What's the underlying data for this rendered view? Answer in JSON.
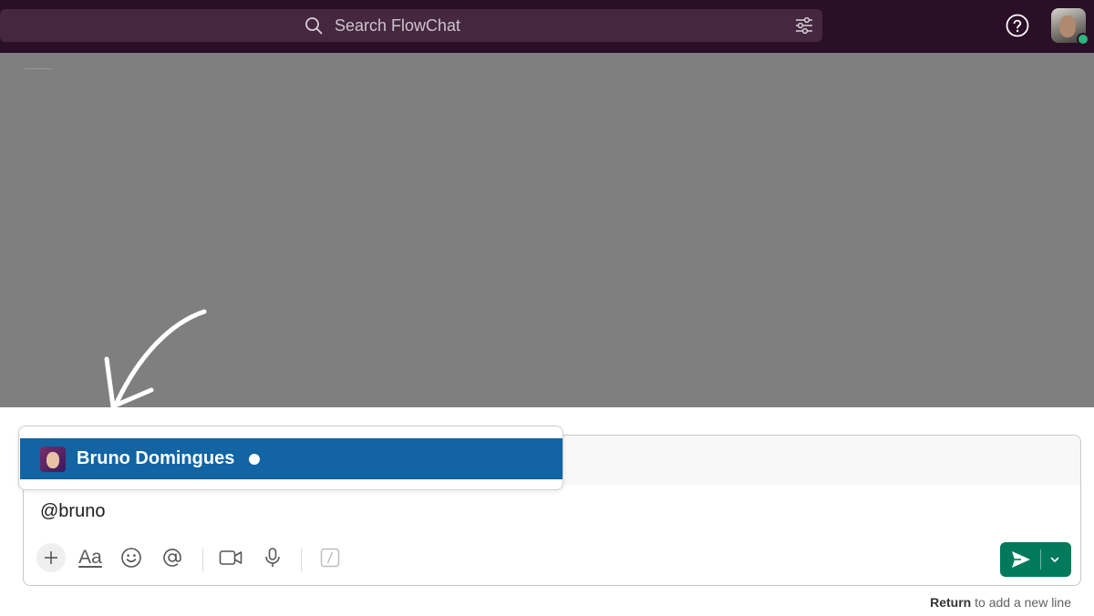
{
  "app": {
    "search_placeholder": "Search FlowChat",
    "icons": {
      "search": "search-icon",
      "filter": "sliders-icon",
      "help": "help-circle-icon"
    }
  },
  "mention_popup": {
    "items": [
      {
        "name": "Bruno Domingues",
        "status": "online",
        "selected": true
      }
    ]
  },
  "composer": {
    "text": "@bruno",
    "toolbar": {
      "add": "plus-icon",
      "format_label": "Aa",
      "emoji": "smile-icon",
      "mention": "at-sign-icon",
      "video": "video-icon",
      "audio": "microphone-icon",
      "shortcuts": "slash-icon"
    },
    "send": "send-icon",
    "send_options": "chevron-down-icon"
  },
  "hint": {
    "key": "Return",
    "text": " to add a new line"
  },
  "colors": {
    "topbar": "#2a0f27",
    "search_bg": "#45283f",
    "selected_row": "#1264a3",
    "send_button": "#007a5a",
    "presence": "#2eb67d"
  }
}
